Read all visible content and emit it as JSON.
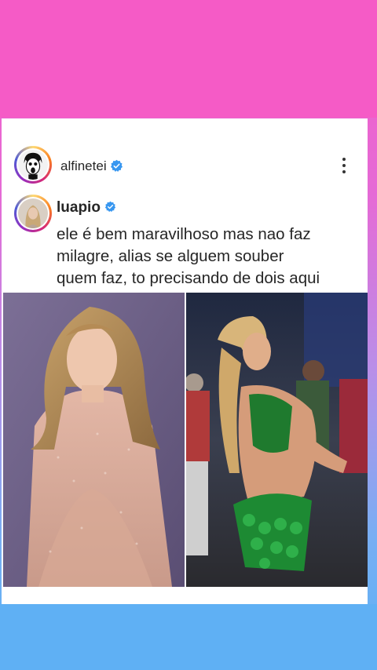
{
  "post": {
    "account_name": "alfinetei",
    "more_icon": "more-vertical-icon"
  },
  "comment": {
    "username": "luapio",
    "lines": [
      "ele é bem maravilhoso mas nao faz",
      "milagre, alias se alguem souber",
      "quem faz, to precisando de dois aqui"
    ]
  },
  "colors": {
    "top_background": "#f55bc6",
    "bottom_background": "#5fb0f4",
    "verified_badge": "#3897f0",
    "text": "#262626"
  },
  "images": [
    {
      "name": "woman-in-sequin-dress-photo"
    },
    {
      "name": "dancer-green-costume-photo"
    }
  ]
}
